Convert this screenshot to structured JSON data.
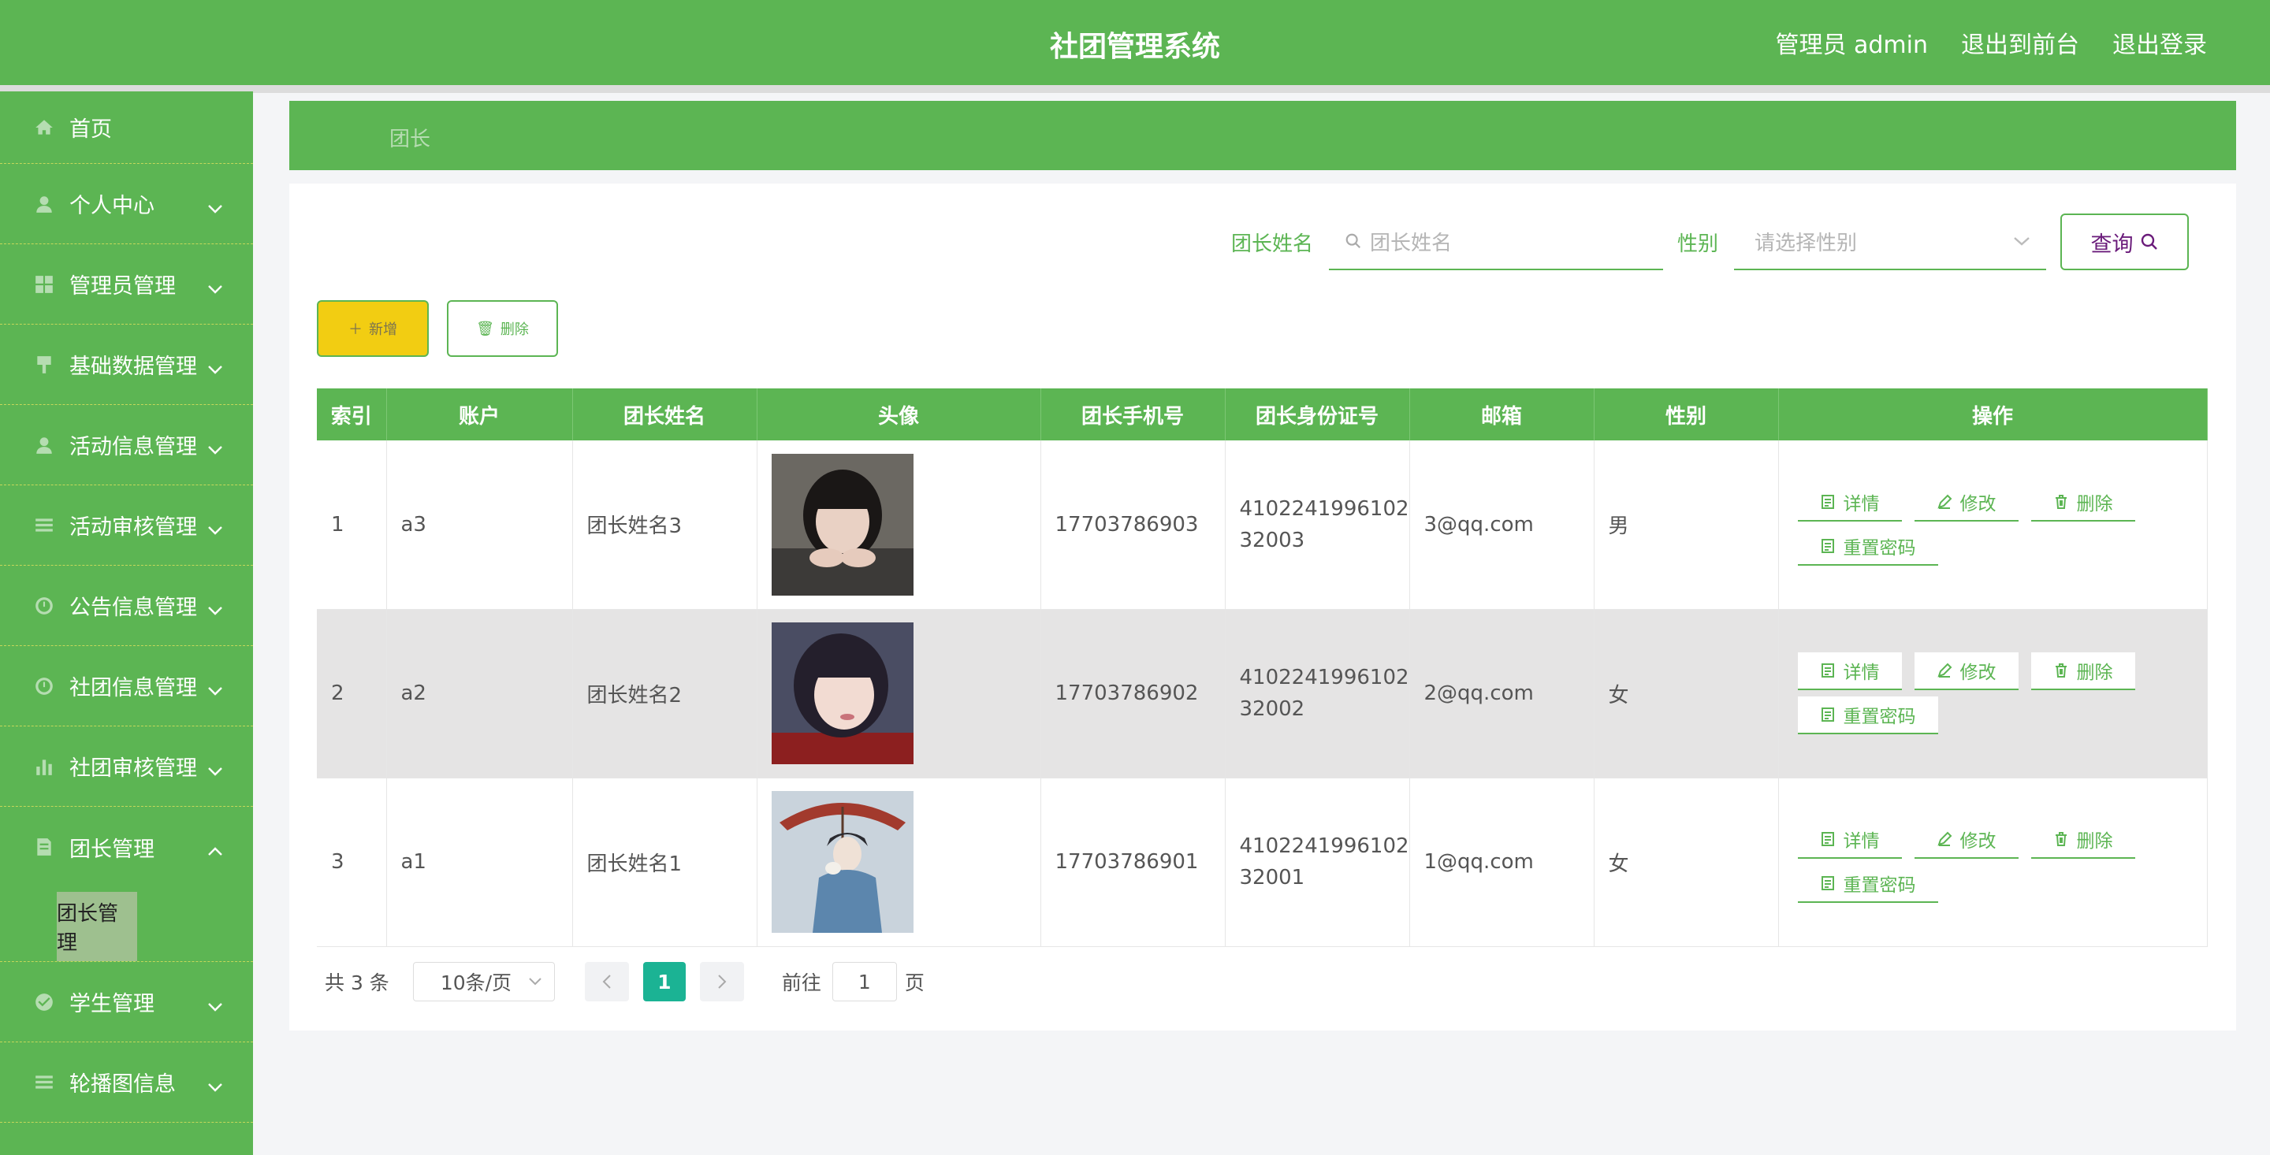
{
  "header": {
    "title": "社团管理系统",
    "user_label": "管理员 admin",
    "to_front_label": "退出到前台",
    "logout_label": "退出登录"
  },
  "sidebar": {
    "items": [
      {
        "label": "首页",
        "icon": "home-icon"
      },
      {
        "label": "个人中心",
        "icon": "user-icon"
      },
      {
        "label": "管理员管理",
        "icon": "grid-icon"
      },
      {
        "label": "基础数据管理",
        "icon": "pin-icon"
      },
      {
        "label": "活动信息管理",
        "icon": "user-icon"
      },
      {
        "label": "活动审核管理",
        "icon": "list-icon"
      },
      {
        "label": "公告信息管理",
        "icon": "clock-icon"
      },
      {
        "label": "社团信息管理",
        "icon": "clock-icon"
      },
      {
        "label": "社团审核管理",
        "icon": "bar-chart-icon"
      },
      {
        "label": "团长管理",
        "icon": "doc-icon"
      },
      {
        "label": "学生管理",
        "icon": "check-circle-icon"
      },
      {
        "label": "轮播图信息",
        "icon": "list-icon"
      }
    ],
    "submenu_label": "团长管理"
  },
  "breadcrumb": {
    "current": "团长"
  },
  "search": {
    "name_label": "团长姓名",
    "name_placeholder": "团长姓名",
    "gender_label": "性别",
    "gender_placeholder": "请选择性别",
    "query_label": "查询"
  },
  "actions": {
    "add_label": "新增",
    "delete_label": "删除"
  },
  "table": {
    "headers": [
      "索引",
      "账户",
      "团长姓名",
      "头像",
      "团长手机号",
      "团长身份证号",
      "邮箱",
      "性别",
      "操作"
    ],
    "rows": [
      {
        "index": "1",
        "account": "a3",
        "name": "团长姓名3",
        "phone": "17703786903",
        "id1": "4102241996102",
        "id2": "32003",
        "email": "3@qq.com",
        "gender": "男"
      },
      {
        "index": "2",
        "account": "a2",
        "name": "团长姓名2",
        "phone": "17703786902",
        "id1": "4102241996102",
        "id2": "32002",
        "email": "2@qq.com",
        "gender": "女"
      },
      {
        "index": "3",
        "account": "a1",
        "name": "团长姓名1",
        "phone": "17703786901",
        "id1": "4102241996102",
        "id2": "32001",
        "email": "1@qq.com",
        "gender": "女"
      }
    ],
    "ops": {
      "detail": "详情",
      "edit": "修改",
      "delete": "删除",
      "reset": "重置密码"
    }
  },
  "pager": {
    "total": "共 3 条",
    "page_size": "10条/页",
    "current_page": "1",
    "goto_label": "前往",
    "goto_value": "1",
    "page_suffix": "页"
  },
  "colors": {
    "primary": "#5cb553",
    "add_button": "#f2cd12",
    "active_page": "#1bb394"
  }
}
